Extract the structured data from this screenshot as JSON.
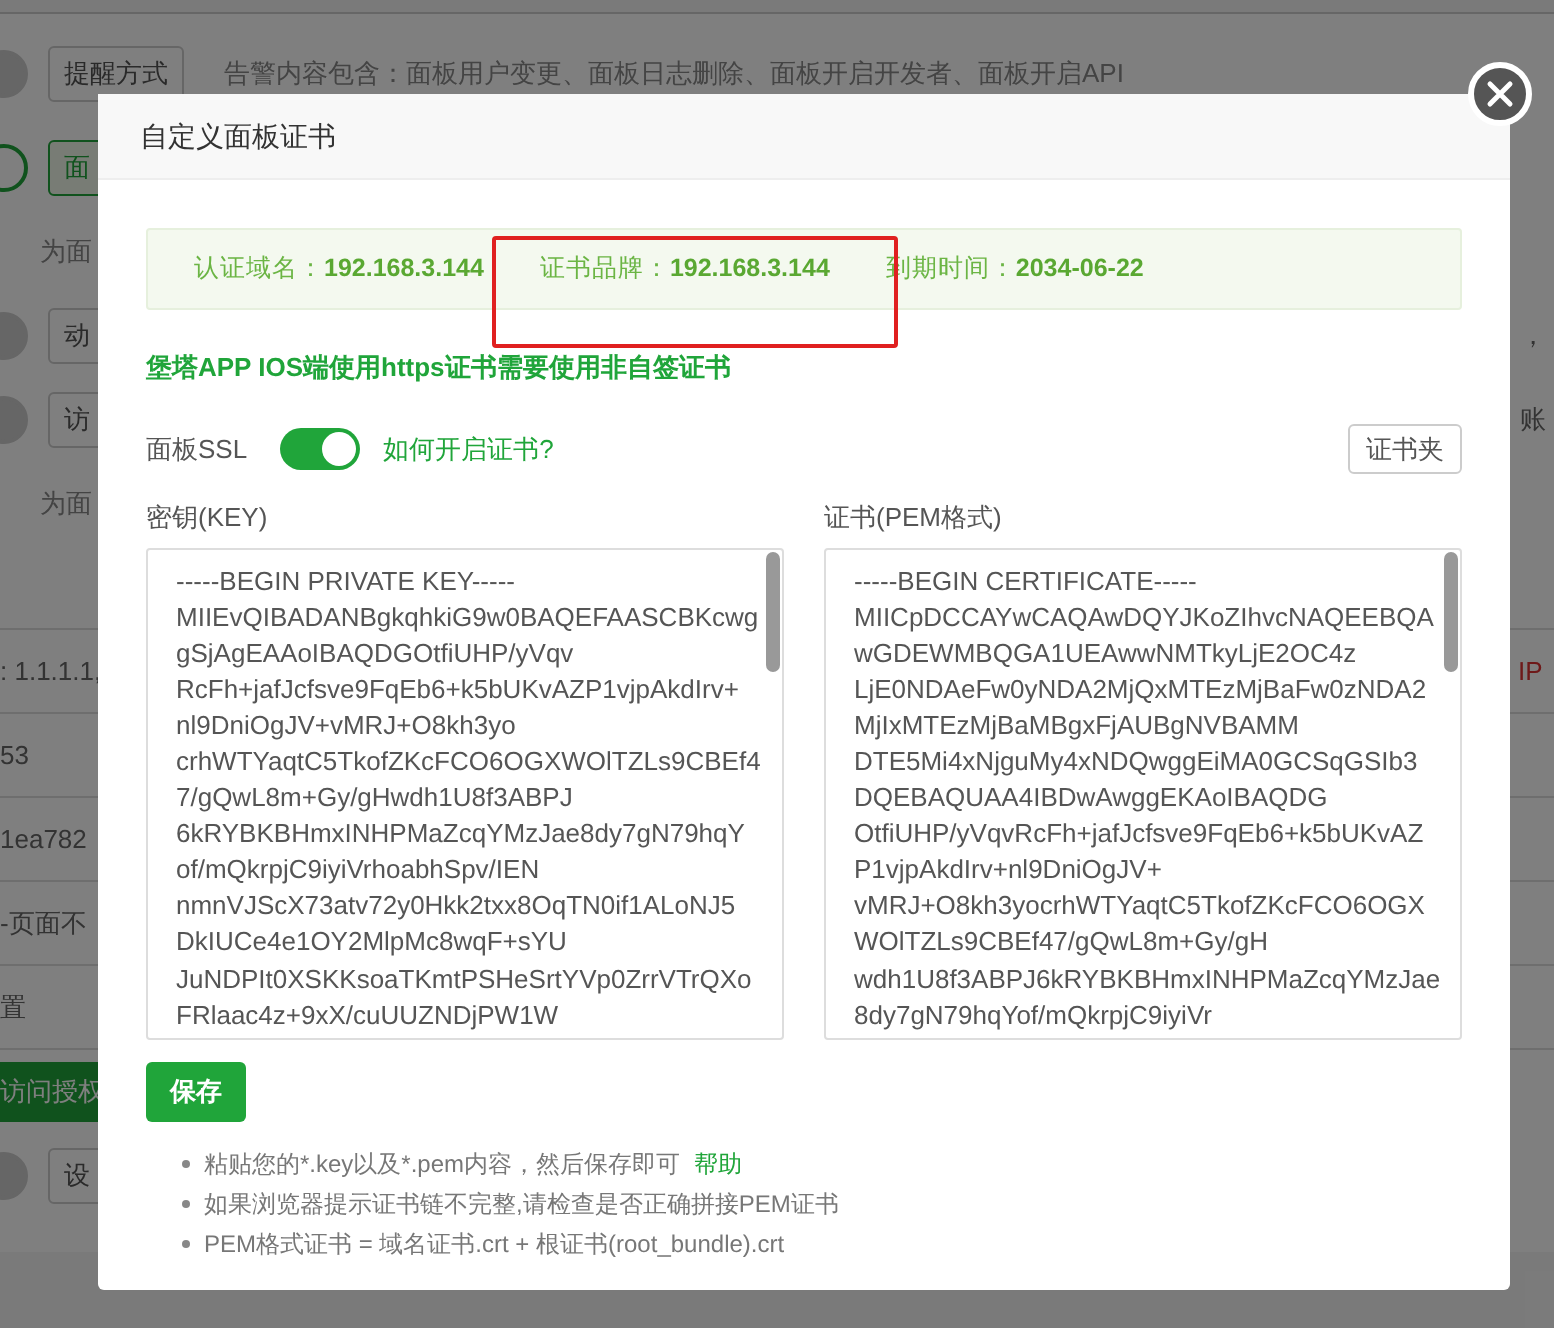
{
  "background": {
    "rows": [
      {
        "kind": "alert",
        "toggle_on": false,
        "button": "提醒方式",
        "text": "告警内容包含：面板用户变更、面板日志删除、面板开启开发者、面板开启API"
      },
      {
        "kind": "button",
        "toggle_on": true,
        "button": "面"
      },
      {
        "kind": "text",
        "text": "为面"
      },
      {
        "kind": "button",
        "toggle_on": false,
        "button": "动",
        "right": "，"
      },
      {
        "kind": "button",
        "toggle_on": false,
        "button": "访",
        "right": "账"
      },
      {
        "kind": "text",
        "text": "为面"
      },
      {
        "kind": "divider"
      },
      {
        "kind": "field",
        "text": ": 1.1.1.1,",
        "right": "IP"
      },
      {
        "kind": "field",
        "text": "53"
      },
      {
        "kind": "field",
        "text": "1ea782"
      },
      {
        "kind": "field",
        "text": "-页面不"
      },
      {
        "kind": "field",
        "text": "置"
      },
      {
        "kind": "banner",
        "text": "访问授权"
      },
      {
        "kind": "button",
        "toggle_on": false,
        "button": "设"
      }
    ]
  },
  "dialog": {
    "title": "自定义面板证书",
    "info": [
      {
        "label": "认证域名：",
        "value": "192.168.3.144"
      },
      {
        "label": "证书品牌：",
        "value": "192.168.3.144"
      },
      {
        "label": "到期时间：",
        "value": "2034-06-22"
      }
    ],
    "notice": "堡塔APP IOS端使用https证书需要使用非自签证书",
    "ssl": {
      "label": "面板SSL",
      "on": true,
      "link": "如何开启证书?"
    },
    "folder_button": "证书夹",
    "key": {
      "label": "密钥(KEY)",
      "lines": [
        "-----BEGIN PRIVATE KEY-----",
        "MIIEvQIBADANBgkqhkiG9w0BAQEFAASCBKcwg",
        "gSjAgEAAoIBAQDGOtfiUHP/yVqv",
        "RcFh+jafJcfsve9FqEb6+k5bUKvAZP1vjpAkdIrv+",
        "nl9DniOgJV+vMRJ+O8kh3yo",
        "crhWTYaqtC5TkofZKcFCO6OGXWOlTZLs9CBEf4",
        "7/gQwL8m+Gy/gHwdh1U8f3ABPJ",
        "6kRYBKBHmxINHPMaZcqYMzJae8dy7gN79hqY",
        "of/mQkrpjC9iyiVrhoabhSpv/IEN",
        "nmnVJScX73atv72y0Hkk2txx8OqTN0if1ALoNJ5",
        "DkIUCe4e1OY2MlpMc8wqF+sYU",
        "JuNDPIt0XSKKsoaTKmtPSHeSrtYVp0ZrrVTrQXo",
        "FRlaac4z+9xX/cuUUZNDjPW1W"
      ]
    },
    "cert": {
      "label": "证书(PEM格式)",
      "lines": [
        "-----BEGIN CERTIFICATE-----",
        "MIICpDCCAYwCAQAwDQYJKoZIhvcNAQEEBQA",
        "wGDEWMBQGA1UEAwwNMTkyLjE2OC4z",
        "LjE0NDAeFw0yNDA2MjQxMTEzMjBaFw0zNDA2",
        "MjIxMTEzMjBaMBgxFjAUBgNVBAMM",
        "DTE5Mi4xNjguMy4xNDQwggEiMA0GCSqGSIb3",
        "DQEBAQUAA4IBDwAwggEKAoIBAQDG",
        "OtfiUHP/yVqvRcFh+jafJcfsve9FqEb6+k5bUKvAZ",
        "P1vjpAkdIrv+nl9DniOgJV+",
        "vMRJ+O8kh3yocrhWTYaqtC5TkofZKcFCO6OGX",
        "WOlTZLs9CBEf47/gQwL8m+Gy/gH",
        "wdh1U8f3ABPJ6kRYBKBHmxINHPMaZcqYMzJae",
        "8dy7gN79hqYof/mQkrpjC9iyiVr"
      ]
    },
    "save_button": "保存",
    "tips": [
      {
        "text": "粘贴您的*.key以及*.pem内容，然后保存即可",
        "link": "帮助"
      },
      {
        "text": "如果浏览器提示证书链不完整,请检查是否正确拼接PEM证书"
      },
      {
        "text": "PEM格式证书 = 域名证书.crt + 根证书(root_bundle).crt"
      }
    ]
  }
}
